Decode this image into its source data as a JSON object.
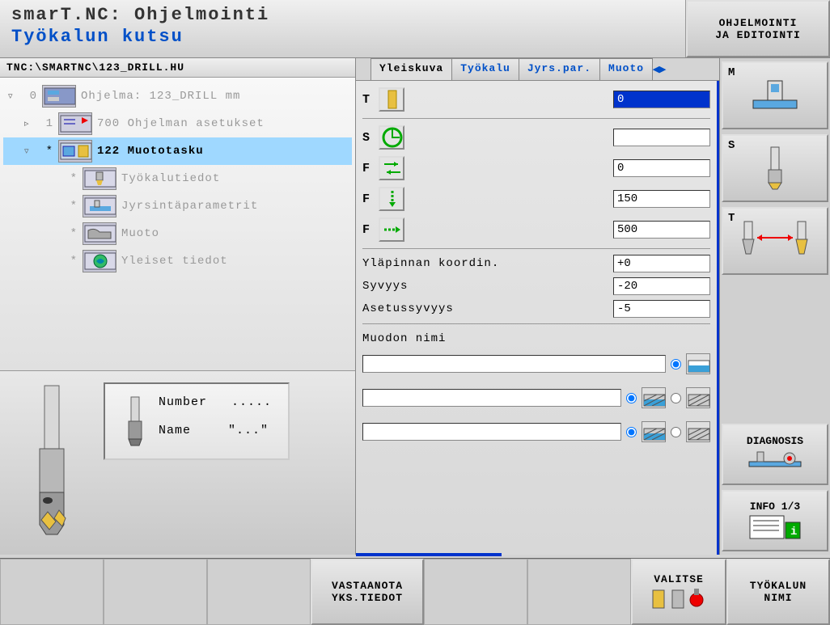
{
  "header": {
    "title_line1": "smarT.NC: Ohjelmointi",
    "title_line2": "Työkalun kutsu",
    "mode_button": "OHJELMOINTI\nJA EDITOINTI"
  },
  "path": "TNC:\\SMARTNC\\123_DRILL.HU",
  "tree": [
    {
      "toggle": "▿",
      "num": "0",
      "label": "Ohjelma: 123_DRILL mm",
      "indent": 0,
      "sel": false
    },
    {
      "toggle": "▹",
      "num": "1",
      "label": "700 Ohjelman asetukset",
      "indent": 1,
      "sel": false
    },
    {
      "toggle": "▿",
      "num": "*",
      "label": "122 Muototasku",
      "indent": 1,
      "sel": true
    },
    {
      "toggle": "",
      "num": "*",
      "label": "Työkalutiedot",
      "indent": 2,
      "sel": false
    },
    {
      "toggle": "",
      "num": "*",
      "label": "Jyrsintäparametrit",
      "indent": 2,
      "sel": false
    },
    {
      "toggle": "",
      "num": "*",
      "label": "Muoto",
      "indent": 2,
      "sel": false
    },
    {
      "toggle": "",
      "num": "*",
      "label": "Yleiset tiedot",
      "indent": 2,
      "sel": false
    }
  ],
  "preview": {
    "number_label": "Number",
    "number_value": ".....",
    "name_label": "Name",
    "name_value": "\"...\""
  },
  "tabs": [
    "Yleiskuva",
    "Työkalu",
    "Jyrs.par.",
    "Muoto"
  ],
  "active_tab": 0,
  "form": {
    "letters": [
      "T",
      "S",
      "F",
      "F",
      "F"
    ],
    "values": [
      "0",
      "",
      "0",
      "150",
      "500"
    ],
    "coord_rows": [
      {
        "label": "Yläpinnan koordin.",
        "value": "+0"
      },
      {
        "label": "Syvyys",
        "value": "-20"
      },
      {
        "label": "Asetussyvyys",
        "value": "-5"
      }
    ],
    "shape_title": "Muodon nimi"
  },
  "side_buttons": {
    "m": "M",
    "s": "S",
    "t": "T",
    "diagnosis": "DIAGNOSIS",
    "info": "INFO 1/3"
  },
  "bottom": {
    "b3a": "VASTAANOTA",
    "b3b": "YKS.TIEDOT",
    "b6": "VALITSE",
    "b7a": "TYÖKALUN",
    "b7b": "NIMI"
  }
}
